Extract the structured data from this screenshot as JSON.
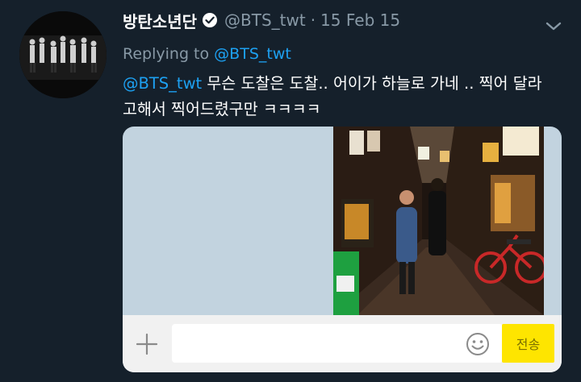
{
  "tweet": {
    "display_name": "방탄소년단",
    "handle": "@BTS_twt",
    "separator": "·",
    "date": "15 Feb 15",
    "replying_prefix": "Replying to",
    "replying_to": "@BTS_twt",
    "body_mention": "@BTS_twt",
    "body_text": " 무슨 도찰은 도찰.. 어이가 하늘로 가네 .. 찍어 달라 고해서 찍어드렸구만 ㅋㅋㅋㅋ"
  },
  "chat": {
    "input_placeholder": "",
    "send_label": "전송"
  },
  "colors": {
    "background": "#15202b",
    "link": "#1da1f2",
    "muted": "#8899a6",
    "send_button": "#fee500",
    "media_bg": "#c2d3df"
  },
  "icons": {
    "verified": "verified-badge-icon",
    "caret": "chevron-down-icon",
    "plus": "plus-icon",
    "emoji": "smiley-icon"
  }
}
